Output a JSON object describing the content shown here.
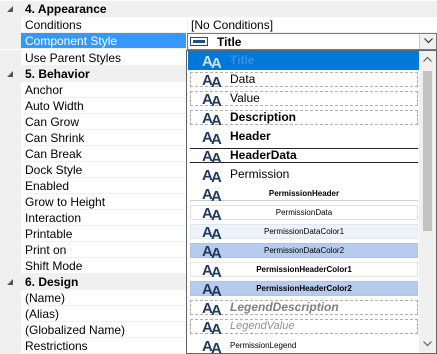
{
  "categories": {
    "appearance": "4. Appearance",
    "behavior": "5. Behavior",
    "design": "6. Design"
  },
  "properties": {
    "appearance": [
      {
        "name": "Conditions",
        "value": "[No Conditions]"
      },
      {
        "name": "Component Style",
        "value": "Title"
      },
      {
        "name": "Use Parent Styles",
        "value": ""
      }
    ],
    "behavior": [
      {
        "name": "Anchor"
      },
      {
        "name": "Auto Width"
      },
      {
        "name": "Can Grow"
      },
      {
        "name": "Can Shrink"
      },
      {
        "name": "Can Break"
      },
      {
        "name": "Dock Style"
      },
      {
        "name": "Enabled"
      },
      {
        "name": "Grow to Height"
      },
      {
        "name": "Interaction"
      },
      {
        "name": "Printable"
      },
      {
        "name": "Print on"
      },
      {
        "name": "Shift Mode"
      }
    ],
    "design": [
      {
        "name": "(Name)"
      },
      {
        "name": "(Alias)"
      },
      {
        "name": "(Globalized Name)"
      },
      {
        "name": "Restrictions"
      }
    ]
  },
  "editor": {
    "value": "Title",
    "dropdown_icon": "chevron-down-icon"
  },
  "style_list": [
    {
      "label": "Title"
    },
    {
      "label": "Data"
    },
    {
      "label": "Value"
    },
    {
      "label": "Description"
    },
    {
      "label": "Header"
    },
    {
      "label": "HeaderData"
    },
    {
      "label": "Permission"
    },
    {
      "label": "PermissionHeader"
    },
    {
      "label": "PermissionData"
    },
    {
      "label": "PermissionDataColor1"
    },
    {
      "label": "PermissionDataColor2"
    },
    {
      "label": "PermissionHeaderColor1"
    },
    {
      "label": "PermissionHeaderColor2"
    },
    {
      "label": "LegendDescription"
    },
    {
      "label": "LegendValue"
    },
    {
      "label": "PermissionLegend"
    }
  ],
  "colors": {
    "selection": "#3399ff",
    "list_highlight": "#0078d7",
    "aa_icon": "#1f3a5f"
  }
}
